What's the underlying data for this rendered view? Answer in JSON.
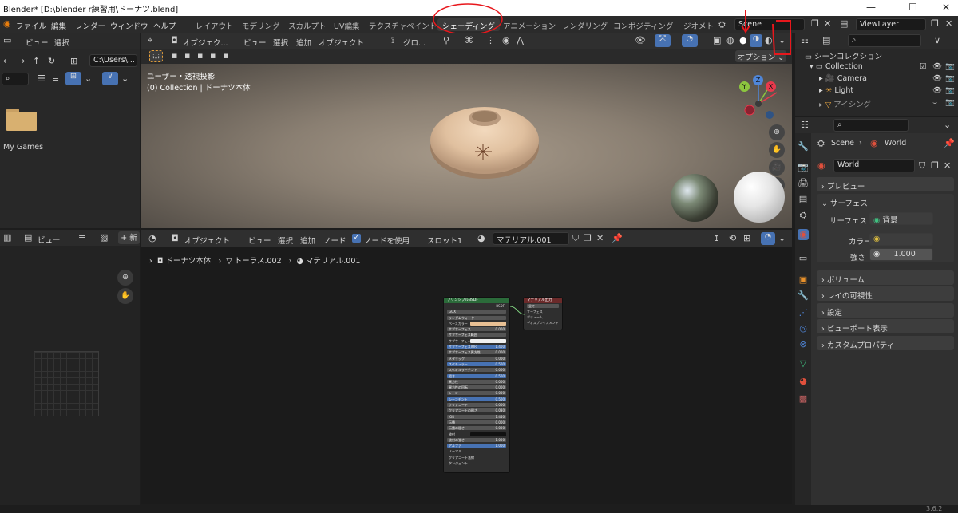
{
  "window": {
    "title": "Blender* [D:\\blender r練習用\\ドーナツ.blend]",
    "minimize": "—",
    "maximize": "☐",
    "close": "✕"
  },
  "menu": [
    "ファイル",
    "編集",
    "レンダー",
    "ウィンドウ",
    "ヘルプ"
  ],
  "workspaces": [
    "レイアウト",
    "モデリング",
    "スカルプト",
    "UV編集",
    "テクスチャペイント",
    "シェーディング",
    "アニメーション",
    "レンダリング",
    "コンポジティング",
    "ジオメト"
  ],
  "active_workspace": "シェーディング",
  "scene_name": "Scene",
  "view_layer": "ViewLayer",
  "file_browser": {
    "header": [
      "ビュー",
      "選択"
    ],
    "path": "C:\\Users\\...",
    "folder_label": "My Games"
  },
  "viewport": {
    "header": {
      "mode": "オブジェク...",
      "menus": [
        "ビュー",
        "選択",
        "追加",
        "オブジェクト"
      ],
      "transform": "グロ..."
    },
    "options_label": "オプション",
    "overlay_line1": "ユーザー・透視投影",
    "overlay_line2": "(0) Collection | ドーナツ本体",
    "gizmo": {
      "x": "X",
      "y": "Y",
      "z": "Z"
    }
  },
  "image_editor": {
    "view_label": "ビュー",
    "new_label": "新"
  },
  "node_editor": {
    "header": {
      "mode": "オブジェクト",
      "menus": [
        "ビュー",
        "選択",
        "追加",
        "ノード"
      ],
      "use_nodes_label": "ノードを使用",
      "slot": "スロット1",
      "material": "マテリアル.001"
    },
    "breadcrumb": [
      "ドーナツ本体",
      "トーラス.002",
      "マテリアル.001"
    ],
    "bsdf_node": {
      "title": "プリンシプルBSDF",
      "output": "BSDF",
      "rows": [
        {
          "label": "GGX",
          "value": ""
        },
        {
          "label": "ランダムウォーク",
          "value": ""
        },
        {
          "label": "ベースカラー",
          "value": ""
        },
        {
          "label": "サブサーフェス",
          "value": "0.000"
        },
        {
          "label": "サブサーフェス範囲",
          "value": ""
        },
        {
          "label": "サブサーフェ...",
          "value": ""
        },
        {
          "label": "サブサーフェスIOR",
          "value": "1.400"
        },
        {
          "label": "サブサーフェス異方性",
          "value": "0.000"
        },
        {
          "label": "メタリック",
          "value": "0.000"
        },
        {
          "label": "スペキュラー",
          "value": "0.500"
        },
        {
          "label": "スペキュラーチント",
          "value": "0.000"
        },
        {
          "label": "粗さ",
          "value": "0.500"
        },
        {
          "label": "異方性",
          "value": "0.000"
        },
        {
          "label": "異方性の回転",
          "value": "0.000"
        },
        {
          "label": "シーン",
          "value": "0.000"
        },
        {
          "label": "シーンチント",
          "value": "0.500"
        },
        {
          "label": "クリアコート",
          "value": "0.000"
        },
        {
          "label": "クリアコートの粗さ",
          "value": "0.030"
        },
        {
          "label": "IOR",
          "value": "1.450"
        },
        {
          "label": "伝播",
          "value": "0.000"
        },
        {
          "label": "伝播の粗さ",
          "value": "0.000"
        },
        {
          "label": "放射",
          "value": ""
        },
        {
          "label": "放射の強さ",
          "value": "1.000"
        },
        {
          "label": "アルファ",
          "value": "1.000"
        },
        {
          "label": "ノーマル",
          "value": ""
        },
        {
          "label": "クリアコート法線",
          "value": ""
        },
        {
          "label": "タンジェント",
          "value": ""
        }
      ]
    },
    "output_node": {
      "title": "マテリアル出力",
      "target": "全て",
      "inputs": [
        "サーフェス",
        "ボリューム",
        "ディスプレイスメント"
      ]
    }
  },
  "outliner": {
    "root": "シーンコレクション",
    "collection": "Collection",
    "items": [
      "Camera",
      "Light",
      "アイシング"
    ]
  },
  "properties": {
    "breadcrumb_scene": "Scene",
    "breadcrumb_world": "World",
    "world_name": "World",
    "panels": {
      "preview": "プレビュー",
      "surface": "サーフェス",
      "volume": "ボリューム",
      "ray_visibility": "レイの可視性",
      "settings": "設定",
      "viewport_display": "ビューポート表示",
      "custom_props": "カスタムプロパティ"
    },
    "surface_label": "サーフェス",
    "surface_value": "背景",
    "color_label": "カラー",
    "strength_label": "強さ",
    "strength_value": "1.000"
  },
  "status": {
    "version": "3.6.2"
  },
  "colors": {
    "annotation_red": "#e8171c",
    "node_header_green": "#2b6b3a",
    "node_header_red": "#6b2a2a",
    "accent_blue": "#4772b3"
  }
}
